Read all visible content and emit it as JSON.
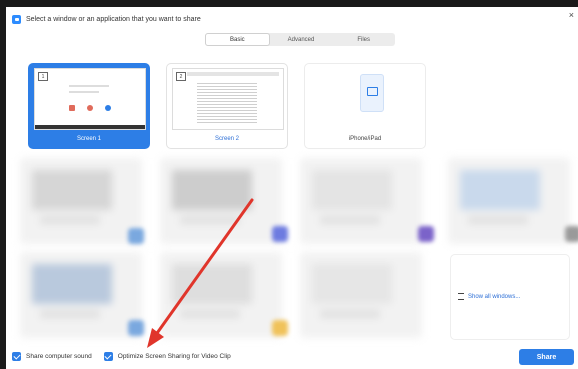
{
  "window": {
    "title": "Select a window or an application that you want to share"
  },
  "tabs": [
    {
      "label": "Basic",
      "active": true
    },
    {
      "label": "Advanced",
      "active": false
    },
    {
      "label": "Files",
      "active": false
    }
  ],
  "tiles": [
    {
      "label": "Screen 1",
      "badge": "1",
      "selected": true
    },
    {
      "label": "Screen 2",
      "badge": "2",
      "selected": false
    },
    {
      "label": "iPhone/iPad",
      "selected": false
    }
  ],
  "show_all": {
    "label": "Show all windows..."
  },
  "footer": {
    "share_sound": "Share computer sound",
    "optimize": "Optimize Screen Sharing for Video Clip"
  },
  "share_button": "Share",
  "colors": {
    "accent": "#2d7ee6",
    "arrow": "#e0352b"
  }
}
